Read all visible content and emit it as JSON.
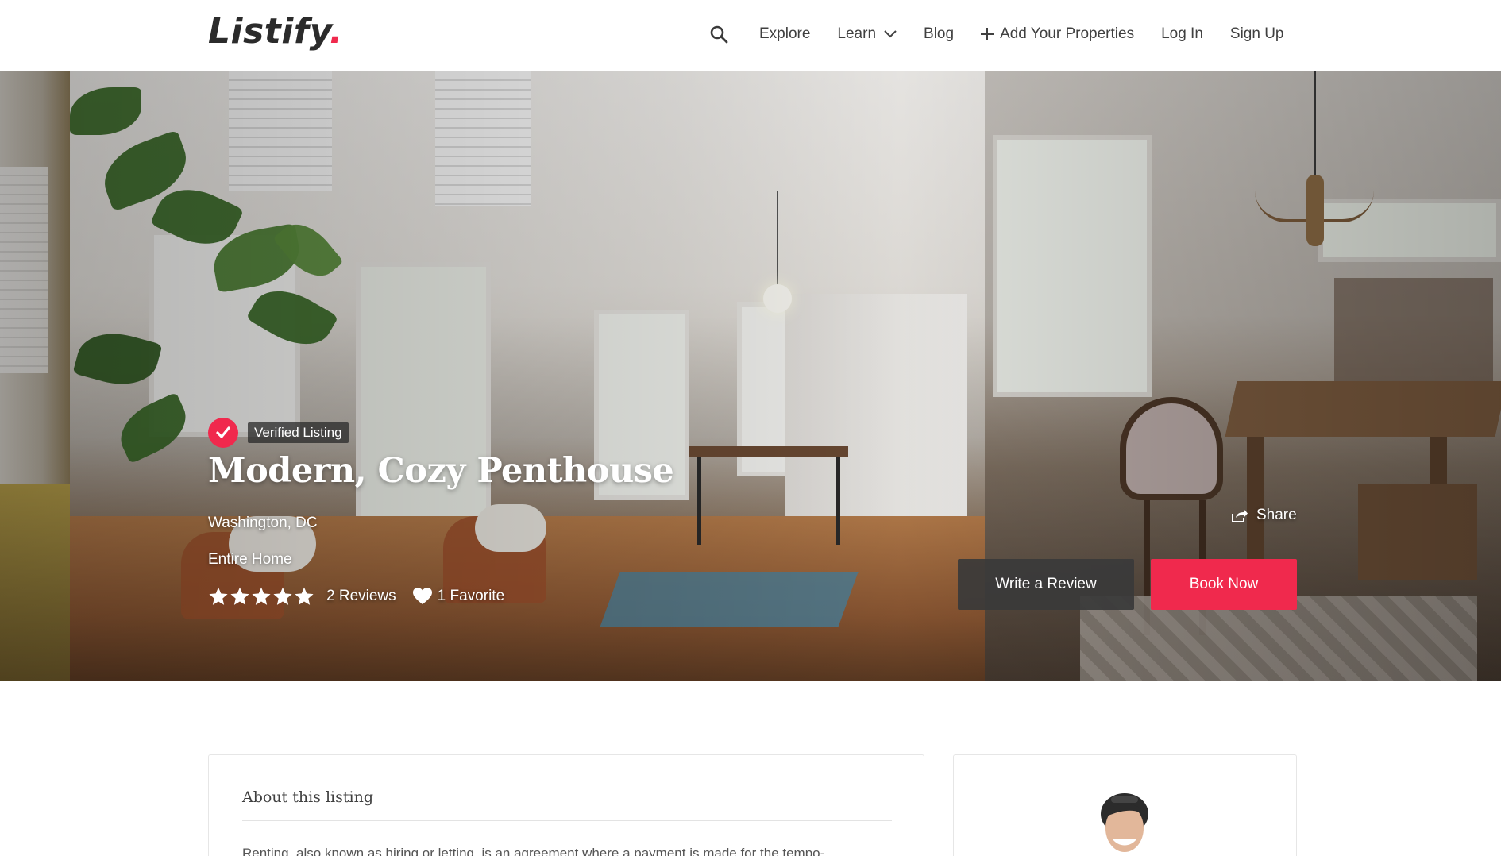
{
  "header": {
    "logo_text": "Listify",
    "logo_dot": ".",
    "nav": {
      "search_icon": "search-icon",
      "explore": "Explore",
      "learn": "Learn",
      "blog": "Blog",
      "add_properties": "Add Your Properties",
      "login": "Log In",
      "signup": "Sign Up"
    }
  },
  "hero": {
    "verified_label": "Verified Listing",
    "title": "Modern, Cozy Penthouse",
    "location": "Washington, DC",
    "type": "Entire Home",
    "rating_stars": 5,
    "reviews": "2 Reviews",
    "favorites": "1 Favorite",
    "share_label": "Share",
    "write_review": "Write a Review",
    "book_now": "Book Now"
  },
  "content": {
    "about_title": "About this listing",
    "about_text": "Renting, also known as hiring or letting, is an agreement where a payment is made for the tempo-"
  },
  "colors": {
    "accent": "#f0294d",
    "dark_button": "#3a3a3a",
    "text": "#404040"
  }
}
